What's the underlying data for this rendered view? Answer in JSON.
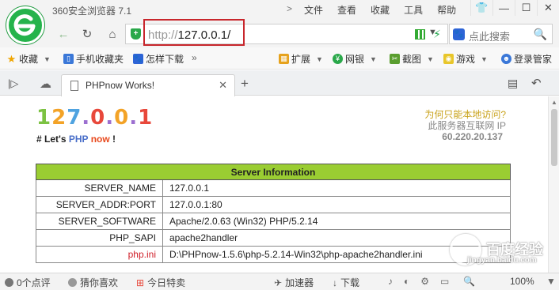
{
  "app": {
    "title": "360安全浏览器 7.1",
    "menu": [
      "文件",
      "查看",
      "收藏",
      "工具",
      "帮助"
    ],
    "menu_chevron": ">",
    "window_controls": [
      "👕",
      "—",
      "☐",
      "✕"
    ]
  },
  "address_bar": {
    "url_scheme": "http://",
    "url_host": "127.0.0.1/",
    "search_engine_icon": "baidu-paw-icon",
    "search_placeholder": "点此搜索"
  },
  "bookmarks": [
    {
      "label": "收藏",
      "icon": "star-icon",
      "dropdown": true
    },
    {
      "label": "手机收藏夹",
      "icon": "phone-icon",
      "dropdown": false
    },
    {
      "label": "怎样下载",
      "icon": "paw-icon",
      "dropdown": false
    },
    {
      "label": "»",
      "icon": "",
      "dropdown": false
    },
    {
      "label": "扩展",
      "icon": "grid-icon",
      "dropdown": true
    },
    {
      "label": "网银",
      "icon": "bank-icon",
      "dropdown": true
    },
    {
      "label": "截图",
      "icon": "scissors-icon",
      "dropdown": true
    },
    {
      "label": "游戏",
      "icon": "gamepad-icon",
      "dropdown": true
    },
    {
      "label": "登录管家",
      "icon": "user-icon",
      "dropdown": false
    }
  ],
  "tabs": [
    {
      "title": "PHPnow Works!",
      "active": true
    }
  ],
  "page": {
    "big_ip_chars": [
      "1",
      "2",
      "7",
      ".",
      "0",
      ".",
      "0",
      ".",
      "1"
    ],
    "big_ip_colors": [
      "#7cc242",
      "#f3a327",
      "#4fa3e0",
      "#9c6fd0",
      "#e8483b",
      "#9c6fd0",
      "#f3a327",
      "#9c6fd0",
      "#e8483b"
    ],
    "tagline_prefix": "# Let's ",
    "tagline_php": "PHP",
    "tagline_now": "now",
    "tagline_suffix": " !",
    "side_question": "为何只能本地访问?",
    "side_text": "此服务器互联网 IP",
    "side_ip": "60.220.20.137",
    "table": {
      "header": "Server Information",
      "rows": [
        {
          "key": "SERVER_NAME",
          "value": "127.0.0.1",
          "highlight": false
        },
        {
          "key": "SERVER_ADDR:PORT",
          "value": "127.0.0.1:80",
          "highlight": false
        },
        {
          "key": "SERVER_SOFTWARE",
          "value": "Apache/2.0.63 (Win32) PHP/5.2.14",
          "highlight": false
        },
        {
          "key": "PHP_SAPI",
          "value": "apache2handler",
          "highlight": false
        },
        {
          "key": "php.ini",
          "value": "D:\\PHPnow-1.5.6\\php-5.2.14-Win32\\php-apache2handler.ini",
          "highlight": true
        }
      ]
    }
  },
  "status_bar": {
    "left": [
      "0个点评",
      "猜你喜欢",
      "今日特卖"
    ],
    "right": [
      "加速器",
      "下载"
    ],
    "zoom": "100%"
  },
  "watermark": {
    "text": "百度经验",
    "sub": "jingyan.baidu.com"
  },
  "colors": {
    "brand_green": "#25b34b",
    "url_highlight": "#c8262c",
    "table_header": "#9acd32",
    "phpini_red": "#d0202a"
  }
}
